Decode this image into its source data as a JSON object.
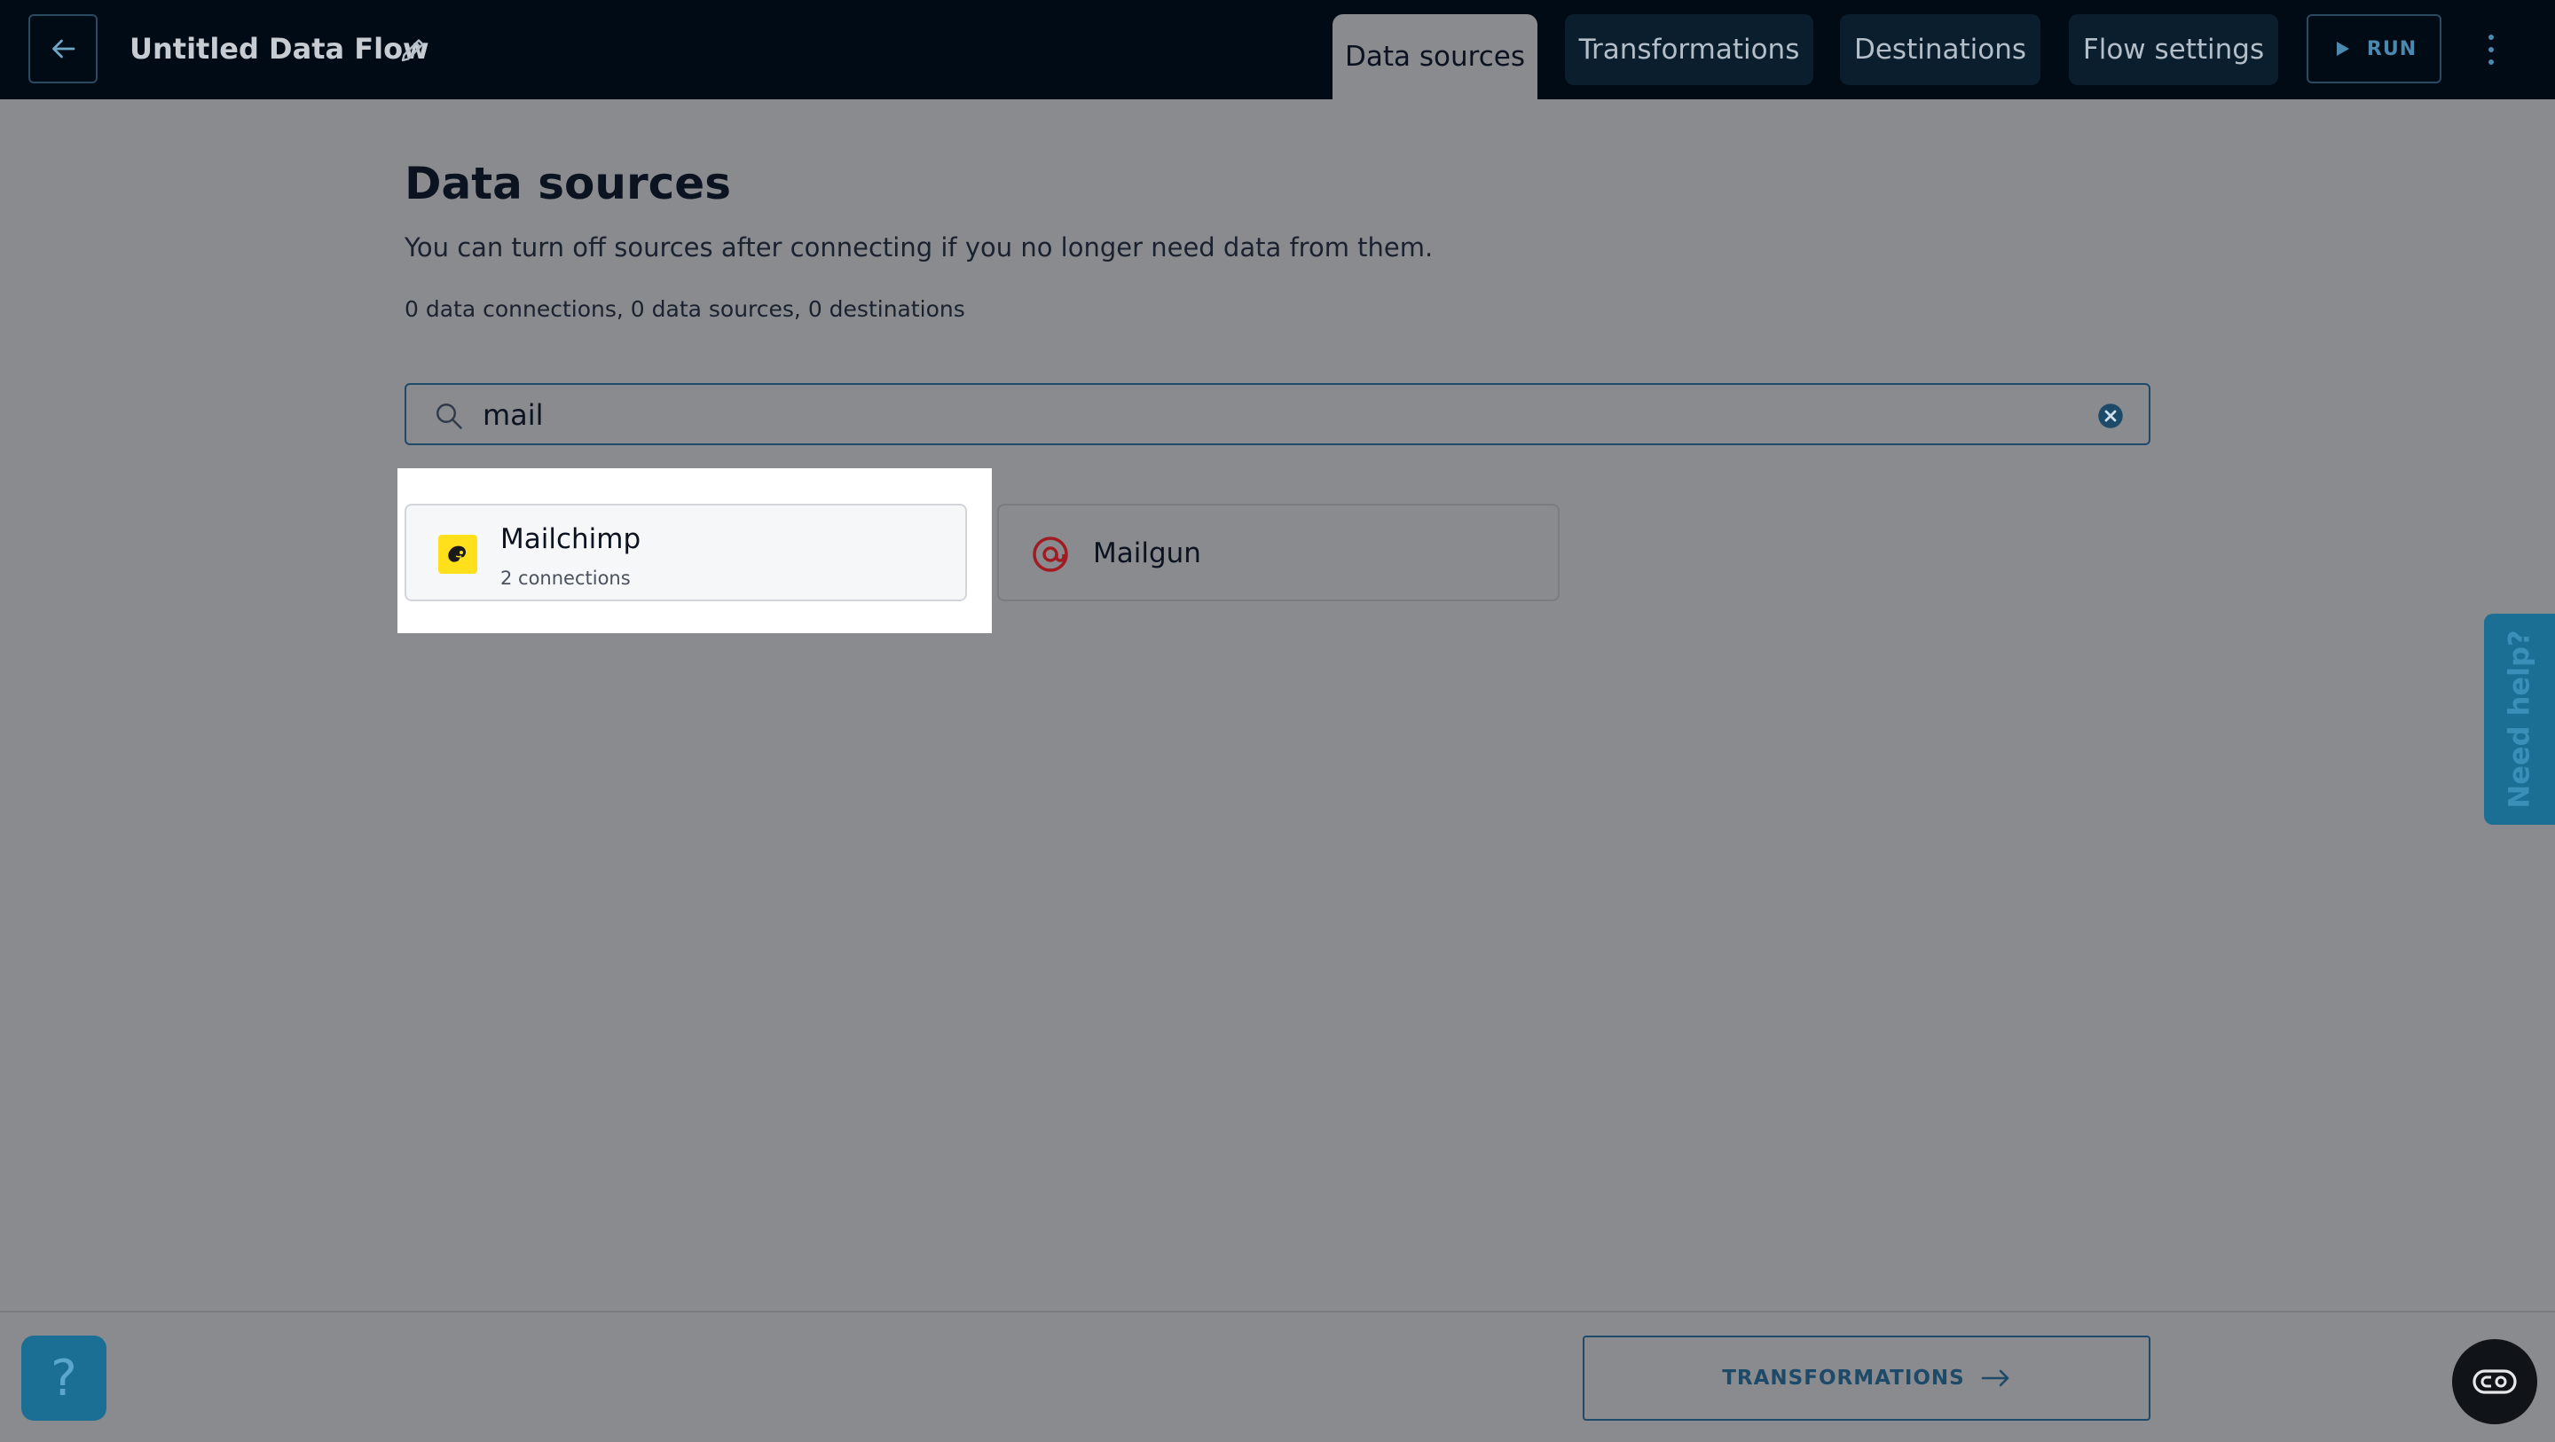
{
  "header": {
    "flow_title": "Untitled Data Flow",
    "tabs": [
      {
        "label": "Data sources",
        "active": true
      },
      {
        "label": "Transformations",
        "active": false
      },
      {
        "label": "Destinations",
        "active": false
      },
      {
        "label": "Flow settings",
        "active": false
      }
    ],
    "run_label": "RUN"
  },
  "main": {
    "title": "Data sources",
    "subtitle": "You can turn off sources after connecting if you no longer need data from them.",
    "counts": "0 data connections, 0 data sources, 0 destinations",
    "search": {
      "value": "mail"
    },
    "results": [
      {
        "name": "Mailchimp",
        "sub": "2 connections",
        "icon": "mailchimp-logo"
      },
      {
        "name": "Mailgun",
        "sub": "",
        "icon": "mailgun-logo"
      }
    ]
  },
  "need_help_label": "Need help?",
  "footer": {
    "help_label": "?",
    "next_label": "TRANSFORMATIONS"
  },
  "colors": {
    "header_bg": "#010b16",
    "overlay_bg": "#8a8b8e",
    "accent": "#1b6f95",
    "mailchimp_yellow": "#ffe01b",
    "mailgun_red": "#c02126"
  }
}
